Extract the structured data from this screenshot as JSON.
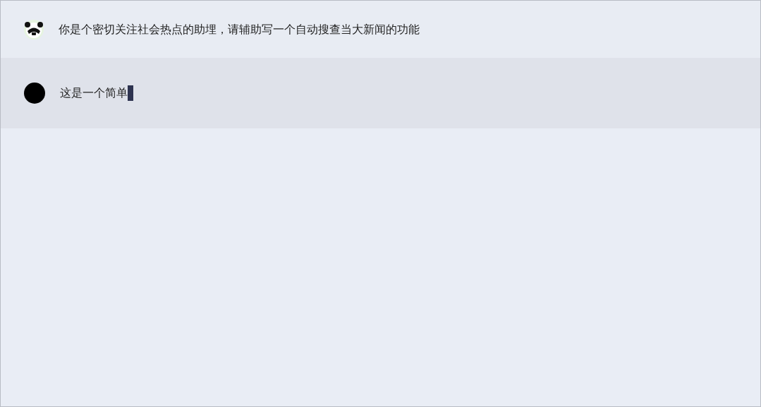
{
  "messages": [
    {
      "kind": "user",
      "text": "你是个密切关注社会热点的助埋，请辅助写一个自动搜查当大新闻的功能",
      "typing": false
    },
    {
      "kind": "bot",
      "text": "这是一个简单",
      "typing": true
    }
  ]
}
